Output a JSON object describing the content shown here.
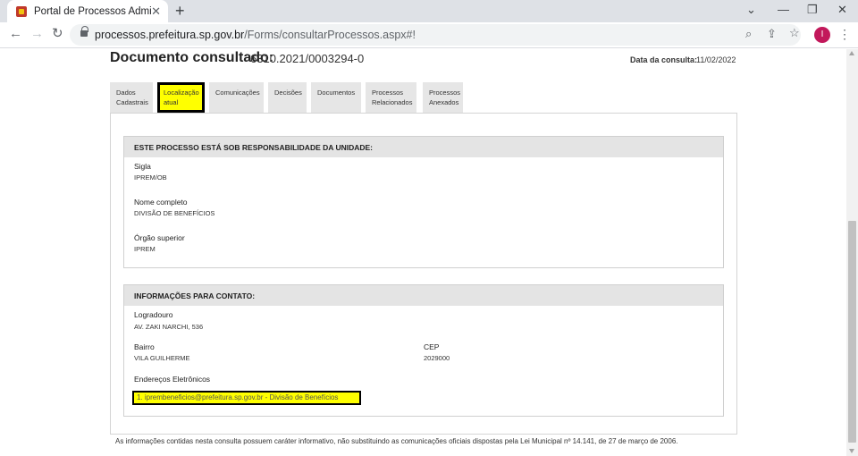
{
  "browser": {
    "tab_title": "Portal de Processos Administratio",
    "new_tab": "+",
    "minimize": "⌄",
    "maximize": "—",
    "restore": "❐",
    "close": "✕",
    "back": "←",
    "forward": "→",
    "reload": "↻",
    "url_domain": "processos.prefeitura.sp.gov.br",
    "url_path": "/Forms/consultarProcessos.aspx#!",
    "zoom_icon": "⌕",
    "share_icon": "⇪",
    "star_icon": "☆",
    "avatar_initial": "I",
    "menu": "⋮"
  },
  "page": {
    "doc_label": "Documento consultado:",
    "doc_number": "6310.2021/0003294-0",
    "date_label": "Data da consulta:",
    "date_value": "11/02/2022",
    "tabs": [
      {
        "line1": "Dados",
        "line2": "Cadastrais"
      },
      {
        "line1": "Localização",
        "line2": "atual"
      },
      {
        "line1": "Comunicações",
        "line2": ""
      },
      {
        "line1": "Decisões",
        "line2": ""
      },
      {
        "line1": "Documentos",
        "line2": ""
      },
      {
        "line1": "Processos",
        "line2": "Relacionados"
      },
      {
        "line1": "Processos",
        "line2": "Anexados"
      }
    ],
    "responsibility": {
      "heading": "ESTE PROCESSO ESTÁ SOB RESPONSABILIDADE DA UNIDADE:",
      "sigla_label": "Sigla",
      "sigla_value": "IPREM/OB",
      "nome_label": "Nome completo",
      "nome_value": "DIVISÃO DE BENEFÍCIOS",
      "orgao_label": "Órgão superior",
      "orgao_value": "IPREM"
    },
    "contact": {
      "heading": "INFORMAÇÕES PARA CONTATO:",
      "logradouro_label": "Logradouro",
      "logradouro_value": "AV. ZAKI NARCHI, 536",
      "bairro_label": "Bairro",
      "bairro_value": "VILA GUILHERME",
      "cep_label": "CEP",
      "cep_value": "2029000",
      "emails_label": "Endereços Eletrônicos",
      "email_item": "1. iprembeneficios@prefeitura.sp.gov.br - Divisão de Benefícios"
    },
    "footer": "As informações contidas nesta consulta possuem caráter informativo, não substituindo as comunicações oficiais dispostas pela Lei Municipal nº 14.141, de 27 de março de 2006."
  }
}
